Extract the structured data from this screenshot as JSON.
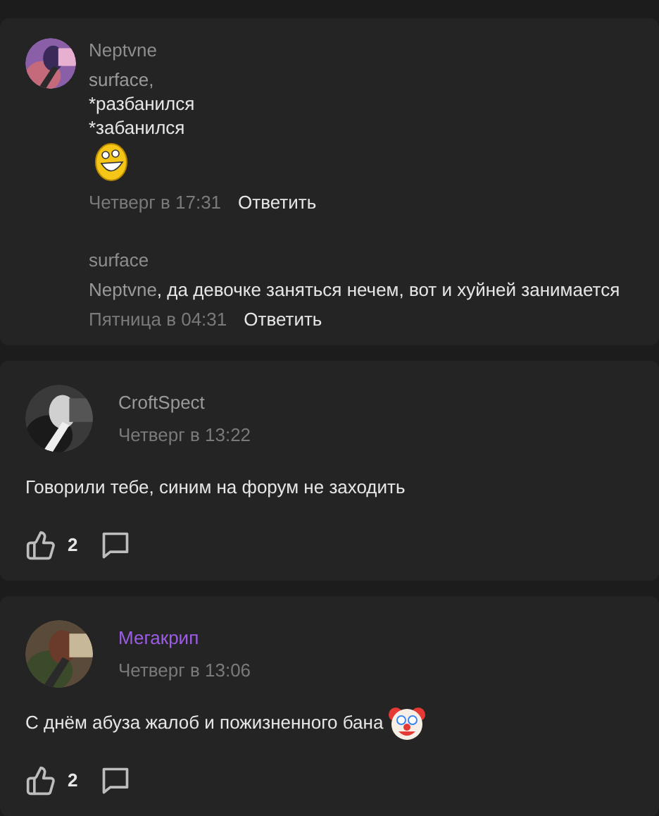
{
  "thread": {
    "replies": [
      {
        "author": "Neptvne",
        "has_avatar": true,
        "mention": "surface,",
        "lines": [
          "*разбанился",
          "*забанился"
        ],
        "sticker": true,
        "time": "Четверг в 17:31",
        "reply_label": "Ответить"
      },
      {
        "author": "surface",
        "has_avatar": false,
        "mention": "Neptvne",
        "lines": [
          ", да девочке заняться нечем, вот и хуйней занимается"
        ],
        "sticker": false,
        "time": "Пятница в 04:31",
        "reply_label": "Ответить"
      }
    ]
  },
  "posts": [
    {
      "author": "CroftSpect",
      "color": "#9a9a9a",
      "time": "Четверг в 13:22",
      "text": "Говорили тебе, синим на форум не заходить",
      "emoji": false,
      "likes": "2"
    },
    {
      "author": "Мегакрип",
      "color": "#9d5ce6",
      "time": "Четверг в 13:06",
      "text": "С днём абуза жалоб и пожизненного бана",
      "emoji": true,
      "likes": "2"
    }
  ]
}
